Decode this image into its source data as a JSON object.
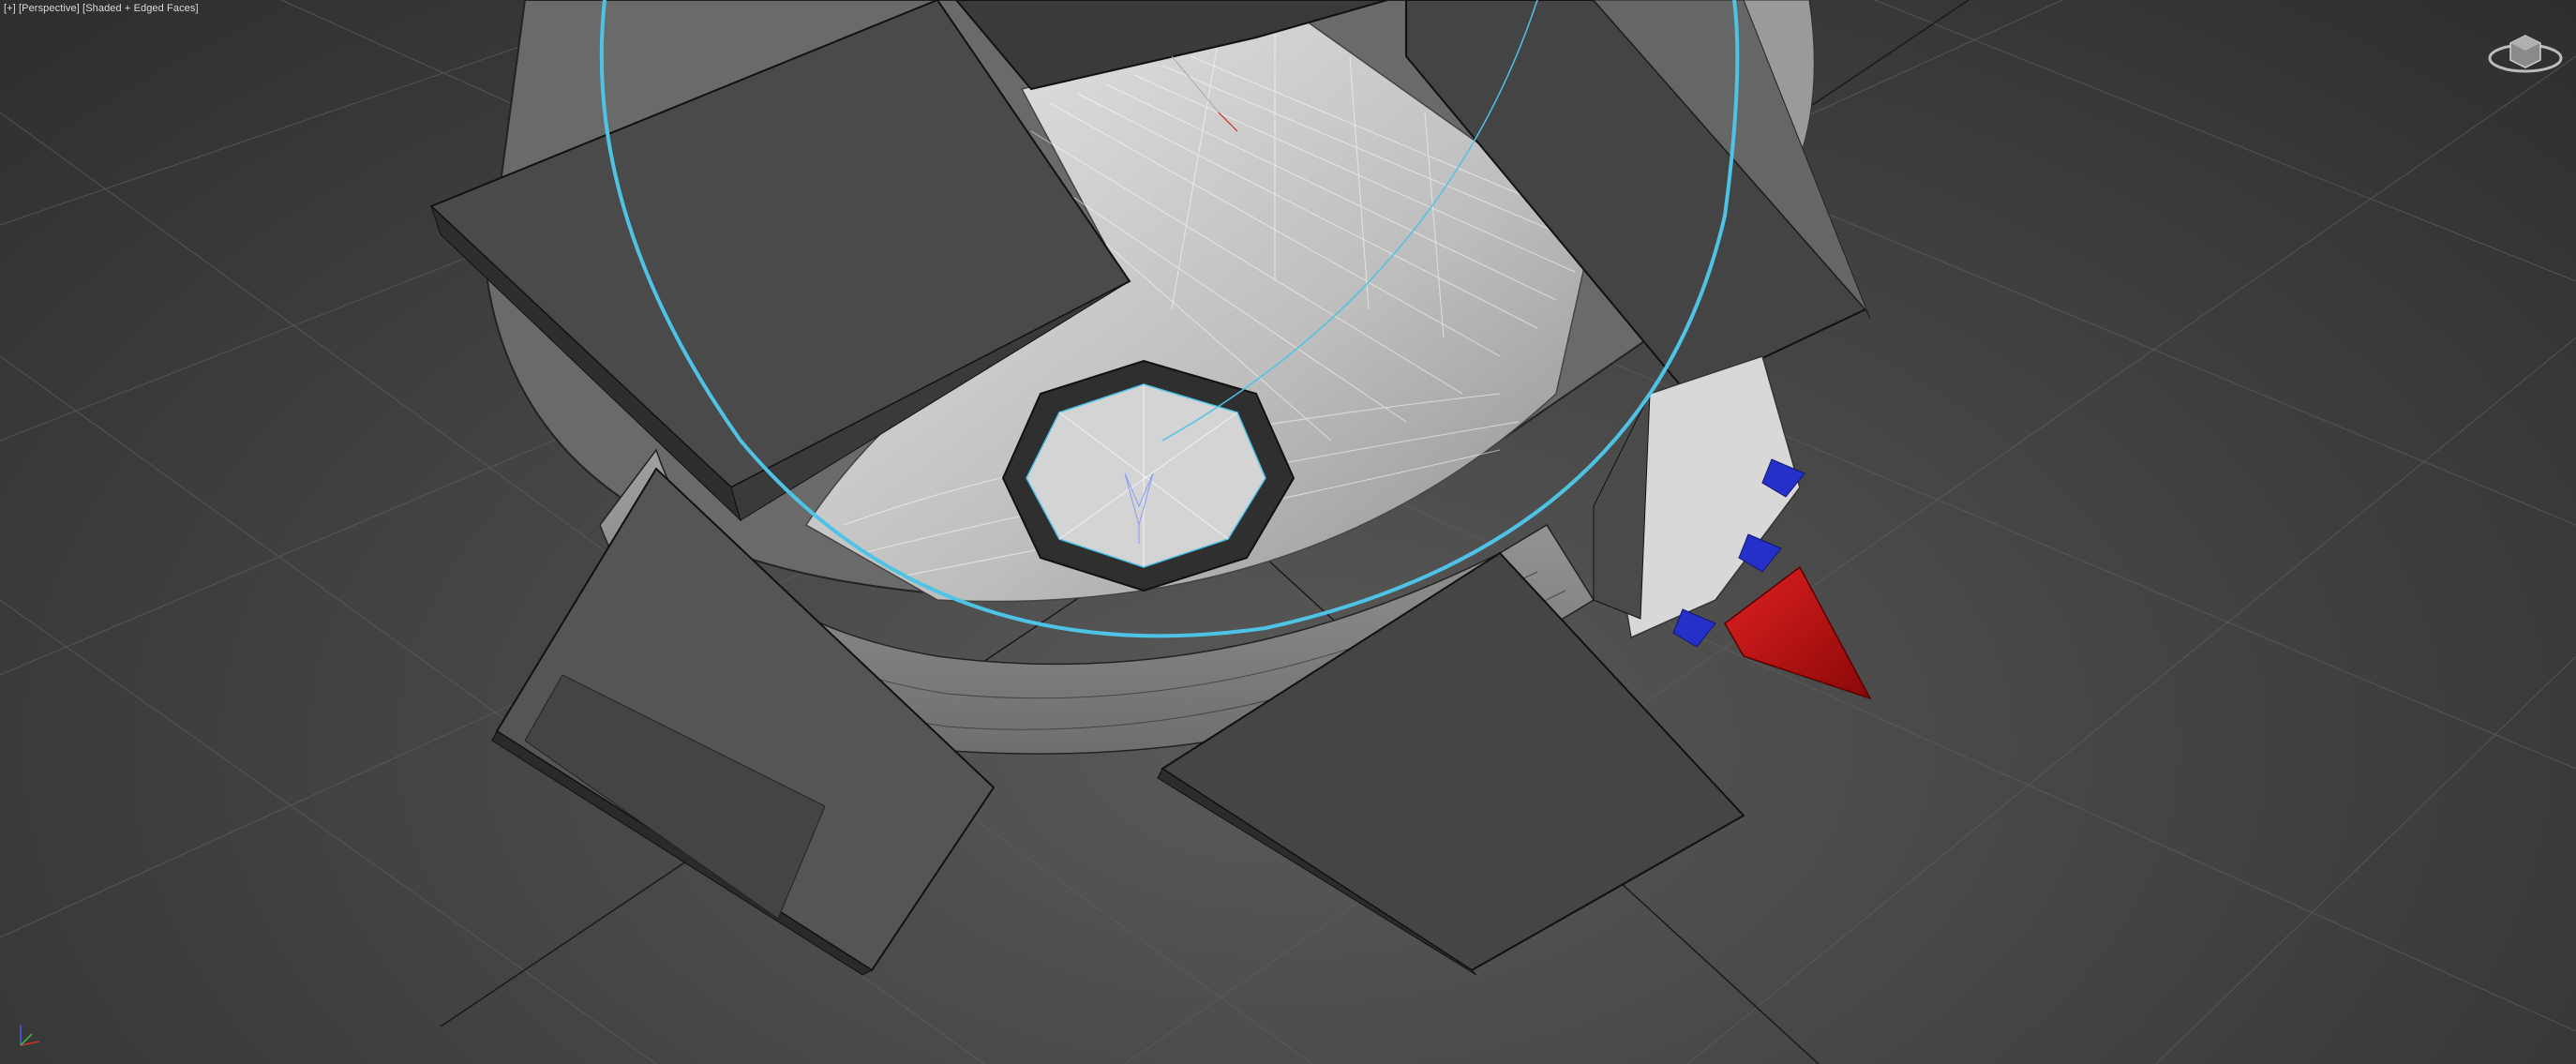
{
  "viewport": {
    "label_plus": "[+]",
    "label_view": "[Perspective]",
    "label_shading": "[Shaded + Edged Faces]"
  },
  "icons": {
    "viewcube": "viewcube-icon",
    "axis_tripod": "axis-tripod-icon",
    "transform_gizmo": "move-gizmo-icon"
  },
  "colors": {
    "background": "#3a3a3a",
    "selection_outline": "#4fc3e6",
    "gizmo_red": "#c81414",
    "gizmo_blue": "#2430c8",
    "mesh_light": "#c8c8c8",
    "mesh_dark": "#3c3c3c"
  }
}
